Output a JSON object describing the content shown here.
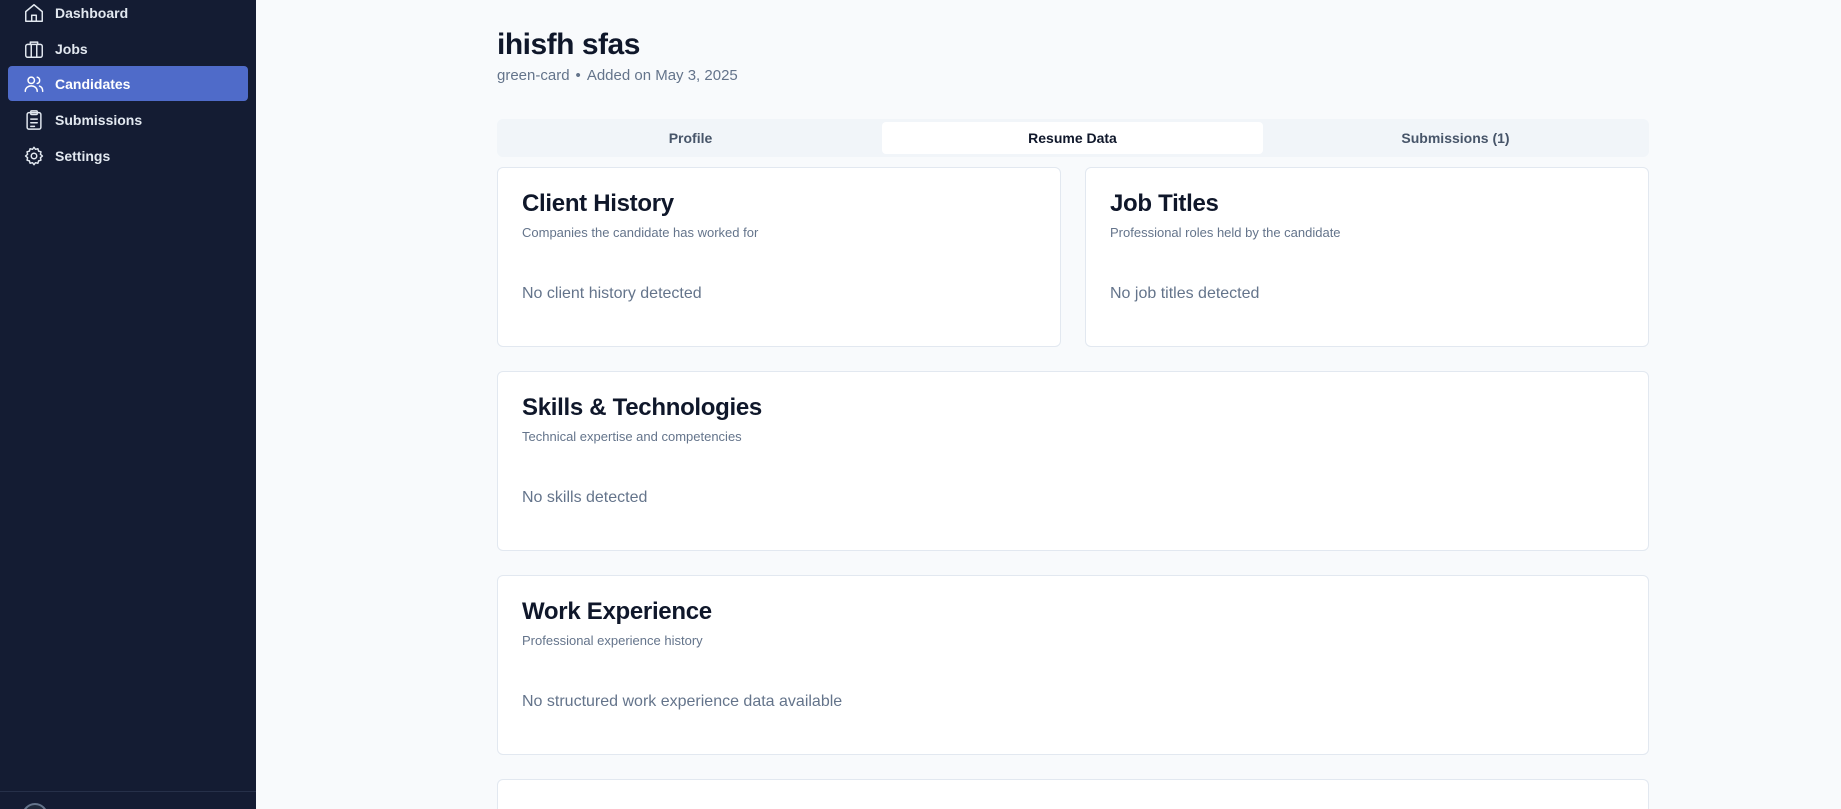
{
  "sidebar": {
    "items": [
      {
        "label": "Dashboard",
        "icon": "home-icon",
        "active": false
      },
      {
        "label": "Jobs",
        "icon": "briefcase-icon",
        "active": false
      },
      {
        "label": "Candidates",
        "icon": "users-icon",
        "active": true
      },
      {
        "label": "Submissions",
        "icon": "clipboard-icon",
        "active": false
      },
      {
        "label": "Settings",
        "icon": "gear-icon",
        "active": false
      }
    ],
    "active_color": "#4f6bc9",
    "background_color": "#141c33"
  },
  "candidate": {
    "name": "ihisfh sfas",
    "status": "green-card",
    "separator": "•",
    "added": "Added on May 3, 2025"
  },
  "tabs": [
    {
      "label": "Profile",
      "active": false
    },
    {
      "label": "Resume Data",
      "active": true
    },
    {
      "label": "Submissions (1)",
      "active": false
    }
  ],
  "cards": {
    "client_history": {
      "title": "Client History",
      "description": "Companies the candidate has worked for",
      "empty": "No client history detected"
    },
    "job_titles": {
      "title": "Job Titles",
      "description": "Professional roles held by the candidate",
      "empty": "No job titles detected"
    },
    "skills": {
      "title": "Skills & Technologies",
      "description": "Technical expertise and competencies",
      "empty": "No skills detected"
    },
    "work_experience": {
      "title": "Work Experience",
      "description": "Professional experience history",
      "empty": "No structured work experience data available"
    }
  }
}
